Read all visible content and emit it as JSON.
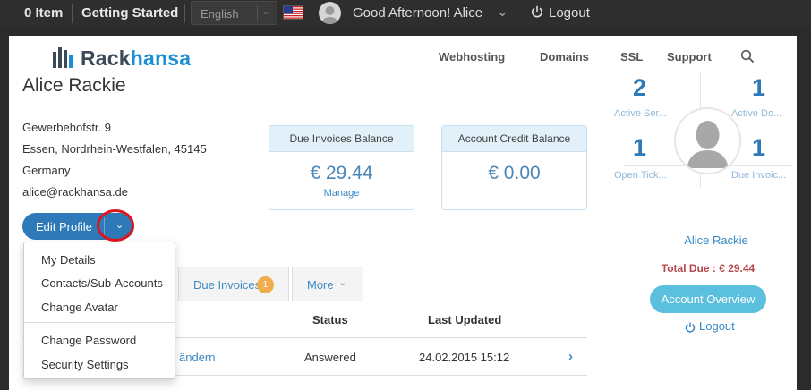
{
  "topbar": {
    "cart": "0 Item",
    "getting_started": "Getting Started",
    "language": "English",
    "greeting": "Good Afternoon! Alice",
    "logout": "Logout"
  },
  "brand": {
    "part1": "Rack",
    "part2": "hansa",
    "accent_color": "#1c8fd6"
  },
  "nav": {
    "items": [
      "Webhosting",
      "Domains",
      "SSL",
      "Support"
    ]
  },
  "profile": {
    "name": "Alice Rackie",
    "address": [
      "Gewerbehofstr. 9",
      "Essen, Nordrhein-Westfalen, 45145",
      "Germany",
      "alice@rackhansa.de"
    ]
  },
  "cards": {
    "due": {
      "title": "Due Invoices Balance",
      "value": "€ 29.44",
      "link": "Manage"
    },
    "credit": {
      "title": "Account Credit Balance",
      "value": "€ 0.00"
    }
  },
  "edit_button": {
    "label": "Edit Profile"
  },
  "dropdown": {
    "items": [
      "My Details",
      "Contacts/Sub-Accounts",
      "Change Avatar",
      "Change Password",
      "Security Settings"
    ]
  },
  "tabs": {
    "due_invoices": "Due Invoices",
    "due_invoices_count": "1",
    "more": "More"
  },
  "table": {
    "headers": {
      "status": "Status",
      "updated": "Last Updated"
    },
    "row": {
      "subject": "ändern",
      "status": "Answered",
      "updated": "24.02.2015 15:12"
    }
  },
  "sidebar": {
    "stats": [
      {
        "value": "2",
        "label": "Active Ser..."
      },
      {
        "value": "1",
        "label": "Active Do..."
      },
      {
        "value": "1",
        "label": "Open Tick..."
      },
      {
        "value": "1",
        "label": "Due Invoic..."
      }
    ],
    "name": "Alice Rackie",
    "total_due": "Total Due : € 29.44",
    "overview_button": "Account Overview",
    "logout": "Logout"
  },
  "colors": {
    "primary": "#2e79b8",
    "info": "#5bc0de",
    "danger": "#b8474a",
    "badge": "#f0ad4e"
  },
  "icons": [
    "us-flag-icon",
    "user-avatar-icon",
    "chevron-down-icon",
    "power-icon",
    "search-icon",
    "logo-bars-icon",
    "chevron-right-icon"
  ]
}
